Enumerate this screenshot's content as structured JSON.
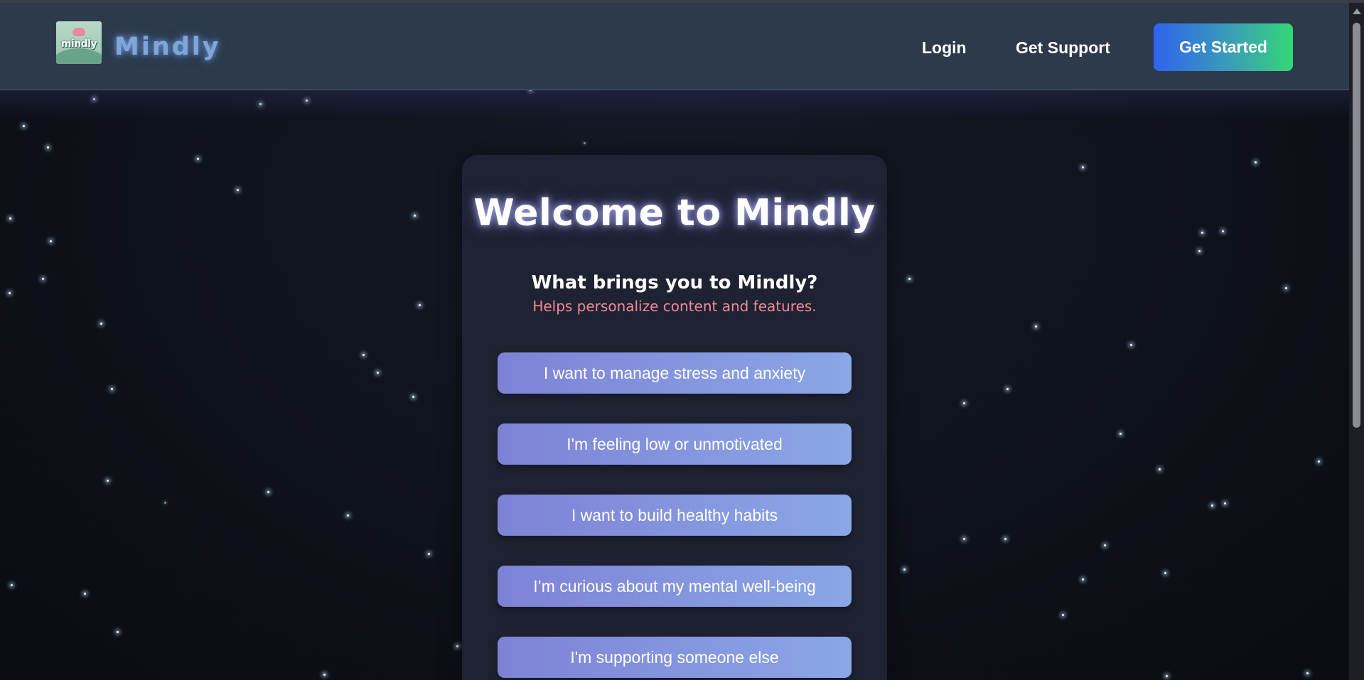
{
  "header": {
    "logo_text": "mindly",
    "brand": "Mindly",
    "nav": {
      "login": "Login",
      "support": "Get Support",
      "cta": "Get Started"
    }
  },
  "card": {
    "title": "Welcome to Mindly",
    "question": "What brings you to Mindly?",
    "subtitle": "Helps personalize content and features.",
    "options": [
      "I want to manage stress and anxiety",
      "I'm feeling low or unmotivated",
      "I want to build healthy habits",
      "I’m curious about my mental well-being",
      "I'm supporting someone else"
    ]
  },
  "colors": {
    "header_bg": "#2c3a4b",
    "card_bg": "#1e2232",
    "subtitle": "#f28a95",
    "cta_start": "#2f63ef",
    "cta_end": "#35d777",
    "option_start": "#7e82d6",
    "option_end": "#8aa7e6"
  }
}
